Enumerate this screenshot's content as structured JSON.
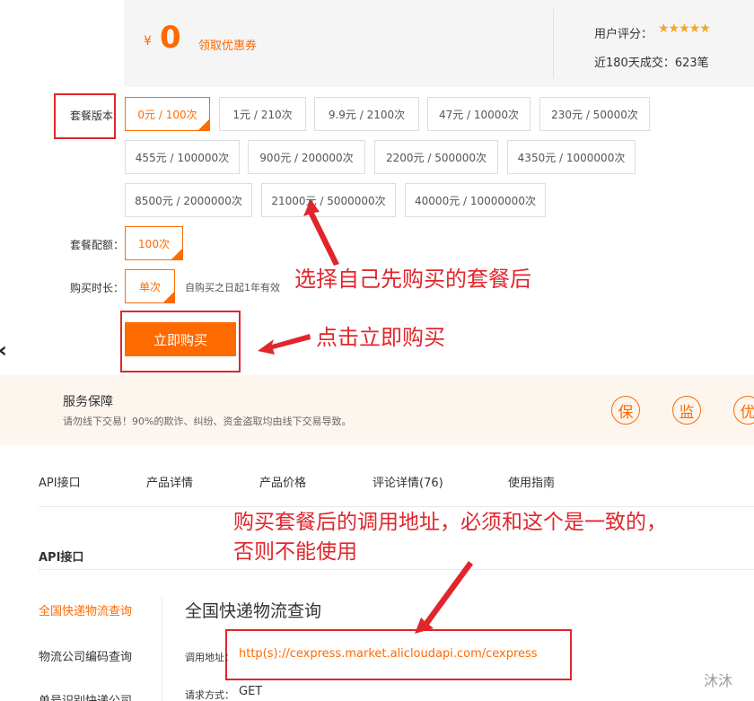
{
  "price": {
    "currency": "¥",
    "value": "0",
    "coupon_label": "领取优惠券"
  },
  "rating": {
    "label": "用户评分：",
    "stars": "★★★★★",
    "deals": "近180天成交：623笔"
  },
  "packages": {
    "label": "套餐版本",
    "items": [
      "0元 / 100次",
      "1元 / 210次",
      "9.9元 / 2100次",
      "47元 / 10000次",
      "230元 / 50000次",
      "455元 / 100000次",
      "900元 / 200000次",
      "2200元 / 500000次",
      "4350元 / 1000000次",
      "8500元 / 2000000次",
      "21000元 / 5000000次",
      "40000元 / 10000000次"
    ],
    "selected_index": 0
  },
  "quota": {
    "label": "套餐配额：",
    "value": "100次"
  },
  "duration": {
    "label": "购买时长：",
    "value": "单次",
    "note": "自购买之日起1年有效"
  },
  "buy_button": "立即购买",
  "service": {
    "title": "服务保障",
    "description": "请勿线下交易！90%的欺诈、纠纷、资金盗取均由线下交易导致。",
    "badges": [
      "保",
      "监",
      "优"
    ]
  },
  "tabs": [
    "API接口",
    "产品详情",
    "产品价格",
    "评论详情(76)",
    "使用指南"
  ],
  "section_title": "API接口",
  "sidebar": [
    "全国快递物流查询",
    "物流公司编码查询",
    "单号识别快递公司"
  ],
  "api": {
    "title": "全国快递物流查询",
    "url_label": "调用地址：",
    "url": "http(s)://cexpress.market.alicloudapi.com/cexpress",
    "method_label": "请求方式：",
    "method": "GET"
  },
  "annotations": {
    "select_package": "选择自己先购买的套餐后",
    "click_buy": "点击立即购买",
    "url_note_line1": "购买套餐后的调用地址，必须和这个是一致的，",
    "url_note_line2": "否则不能使用"
  },
  "watermark": "沐沐",
  "colors": {
    "accent": "#ff6a00",
    "annotation_red": "#e0262c",
    "service_bg": "#fdf6ef"
  }
}
